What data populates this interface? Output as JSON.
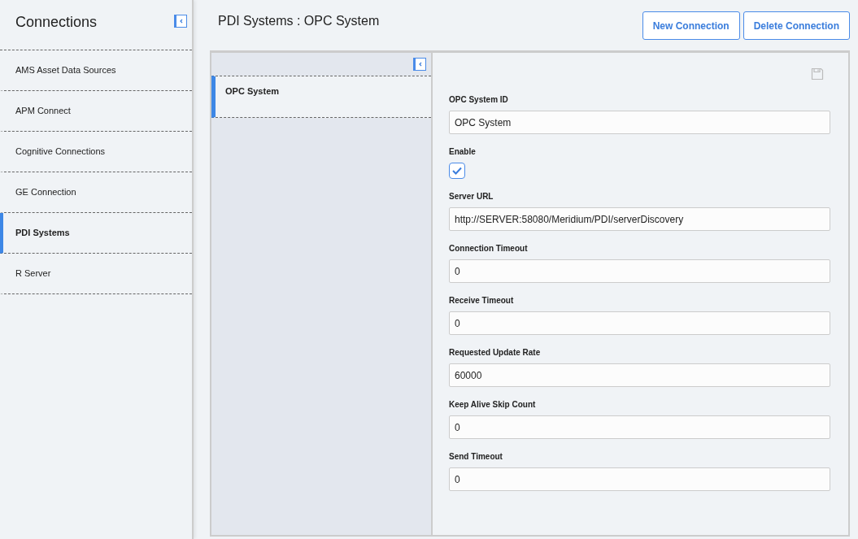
{
  "sidebar": {
    "title": "Connections",
    "items": [
      {
        "label": "AMS Asset Data Sources",
        "selected": false
      },
      {
        "label": "APM Connect",
        "selected": false
      },
      {
        "label": "Cognitive Connections",
        "selected": false
      },
      {
        "label": "GE Connection",
        "selected": false
      },
      {
        "label": "PDI Systems",
        "selected": true
      },
      {
        "label": "R Server",
        "selected": false
      }
    ]
  },
  "main": {
    "title": "PDI Systems : OPC System",
    "buttons": [
      "New Connection",
      "Delete Connection"
    ]
  },
  "records": [
    {
      "label": "OPC System",
      "selected": true
    }
  ],
  "form": {
    "fields": [
      {
        "kind": "text",
        "label": "OPC System ID",
        "value": "OPC System"
      },
      {
        "kind": "checkbox",
        "label": "Enable",
        "checked": true
      },
      {
        "kind": "text",
        "label": "Server URL",
        "value": "http://SERVER:58080/Meridium/PDI/serverDiscovery"
      },
      {
        "kind": "text",
        "label": "Connection Timeout",
        "value": "0"
      },
      {
        "kind": "text",
        "label": "Receive Timeout",
        "value": "0"
      },
      {
        "kind": "text",
        "label": "Requested Update Rate",
        "value": "60000"
      },
      {
        "kind": "text",
        "label": "Keep Alive Skip Count",
        "value": "0"
      },
      {
        "kind": "text",
        "label": "Send Timeout",
        "value": "0"
      }
    ]
  }
}
